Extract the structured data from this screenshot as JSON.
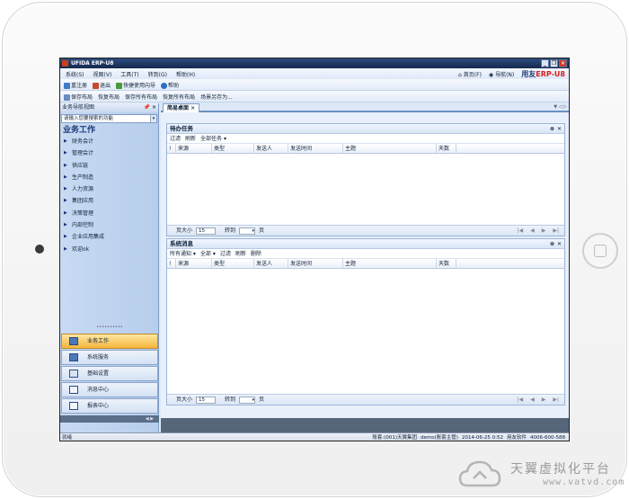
{
  "window": {
    "title": "UFIDA ERP-U8",
    "controls": [
      "_",
      "❐",
      "✕"
    ]
  },
  "menu": {
    "items": [
      "系统(S)",
      "视图(V)",
      "工具(T)",
      "转到(G)",
      "帮助(H)"
    ],
    "home_label": "首页(F)",
    "nav_label": "导航(N)",
    "brand_prefix": "用友",
    "brand_suffix": "ERP-U8"
  },
  "toolbar1": {
    "items": [
      {
        "label": "重注册",
        "color": "#3d7bc7"
      },
      {
        "label": "退出",
        "color": "#c84a2c"
      },
      {
        "label": "快捷使用向导",
        "color": "#4a9a3c"
      },
      {
        "label": "帮助",
        "color": "#2b6fc2"
      }
    ]
  },
  "toolbar2": {
    "items": [
      "保存布局",
      "恢复布局",
      "保存所有布局",
      "恢复所有布局",
      "场景另存为..."
    ]
  },
  "sidebar": {
    "header": "业务导航视图",
    "pin": "📌 ✕",
    "search_placeholder": "请输入您要搜索的功能",
    "section_title": "业务工作",
    "items": [
      "财务会计",
      "管理会计",
      "供应链",
      "生产制造",
      "人力资源",
      "集团应用",
      "决策管理",
      "内部控制",
      "企业应用集成",
      "欢迎ok"
    ],
    "grip": "••••••••••",
    "bottom_items": [
      "业务工作",
      "系统服务",
      "基础设置",
      "消息中心",
      "报表中心"
    ]
  },
  "main": {
    "tab_label": "简易桌面",
    "tab_arrows": "▼ ◁ ▷"
  },
  "todo_panel": {
    "title": "待办任务",
    "ctrls": [
      "⊗",
      "✕"
    ],
    "tools": [
      "过滤",
      "刷新",
      "全部任务 ▾"
    ],
    "columns": [
      "!",
      "来源",
      "类型",
      "发送人",
      "发送时间",
      "主题",
      "天数"
    ],
    "page_size_label": "页大小",
    "page_size": "15",
    "goto_label": "转到",
    "page_label": "页"
  },
  "msg_panel": {
    "title": "系统消息",
    "ctrls": [
      "⊗",
      "✕"
    ],
    "tools": [
      "所有通知 ▾",
      "全部 ▾",
      "过滤",
      "刷新",
      "删除"
    ],
    "columns": [
      "!",
      "来源",
      "类型",
      "发送人",
      "发送时间",
      "主题",
      "天数"
    ],
    "page_size_label": "页大小",
    "page_size": "15",
    "goto_label": "转到",
    "page_label": "页"
  },
  "statusbar": {
    "left": "就绪",
    "items": [
      "账套:(001)天翼集团",
      "demo(账套主管)",
      "2014-06-25 0:52",
      "用友软件",
      "4006-600-588"
    ]
  },
  "watermark": {
    "line1": "天翼虚拟化平台",
    "line2": "www.vatvd.com"
  }
}
